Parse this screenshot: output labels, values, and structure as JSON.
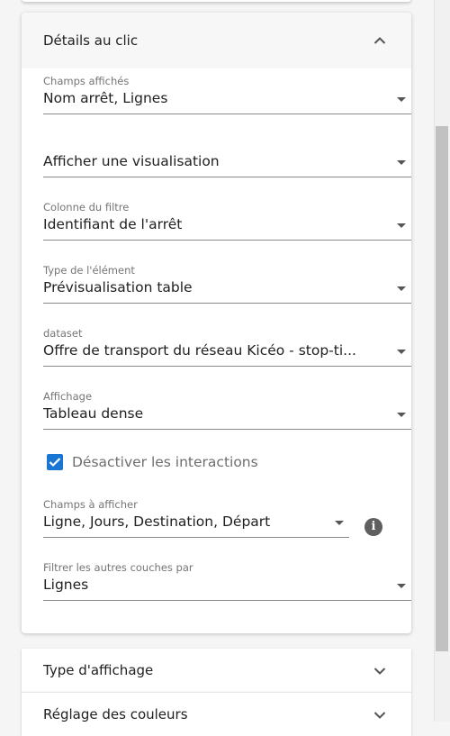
{
  "click_details": {
    "title": "Détails au clic",
    "fields": {
      "displayed_fields": {
        "label": "Champs affichés",
        "value": "Nom arrêt,  Lignes"
      },
      "visualization": {
        "label": "",
        "value": "Afficher une visualisation"
      },
      "filter_column": {
        "label": "Colonne du filtre",
        "value": "Identifiant de l'arrêt"
      },
      "element_type": {
        "label": "Type de l'élément",
        "value": "Prévisualisation table"
      },
      "dataset": {
        "label": "dataset",
        "value": "Offre de transport du réseau Kicéo - stop-ti..."
      },
      "display": {
        "label": "Affichage",
        "value": "Tableau dense"
      },
      "fields_to_show": {
        "label": "Champs à afficher",
        "value": "Ligne,  Jours,  Destination,  Départ"
      },
      "filter_other_layers": {
        "label": "Filtrer les autres couches par",
        "value": "Lignes"
      }
    },
    "disable_interactions": {
      "label": "Désactiver les interactions",
      "checked": true
    }
  },
  "sections": {
    "display_type": {
      "title": "Type d'affichage"
    },
    "color_settings": {
      "title": "Réglage des couleurs"
    }
  },
  "icons": {
    "collapse": "chevron-up-icon",
    "expand": "chevron-down-icon",
    "dropdown": "caret-down-icon",
    "info": "info-icon",
    "check": "check-icon"
  },
  "colors": {
    "accent": "#1976d2",
    "panel_header_bg": "#f7f7f7",
    "info_icon_bg": "#5f5f5f"
  }
}
